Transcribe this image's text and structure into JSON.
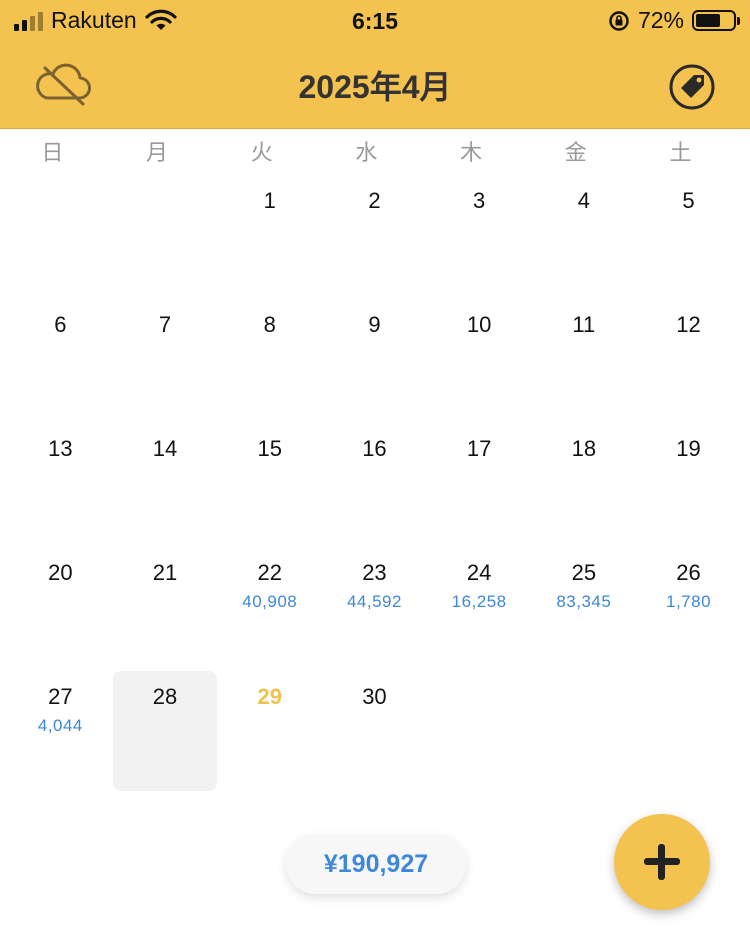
{
  "status_bar": {
    "carrier": "Rakuten",
    "time": "6:15",
    "battery_percent": "72%",
    "battery_level": 0.72,
    "icons": [
      "signal-icon",
      "wifi-icon",
      "rotation-lock-icon",
      "battery-icon"
    ]
  },
  "header": {
    "title": "2025年4月",
    "left_icon": "cloud-off-icon",
    "right_icon": "tag-icon",
    "color": "#F4C24E"
  },
  "weekdays": [
    "日",
    "月",
    "火",
    "水",
    "木",
    "金",
    "土"
  ],
  "calendar": {
    "days": [
      {
        "day": "1",
        "amount": ""
      },
      {
        "day": "2",
        "amount": ""
      },
      {
        "day": "3",
        "amount": ""
      },
      {
        "day": "4",
        "amount": ""
      },
      {
        "day": "5",
        "amount": ""
      },
      {
        "day": "6",
        "amount": ""
      },
      {
        "day": "7",
        "amount": ""
      },
      {
        "day": "8",
        "amount": ""
      },
      {
        "day": "9",
        "amount": ""
      },
      {
        "day": "10",
        "amount": ""
      },
      {
        "day": "11",
        "amount": ""
      },
      {
        "day": "12",
        "amount": ""
      },
      {
        "day": "13",
        "amount": ""
      },
      {
        "day": "14",
        "amount": ""
      },
      {
        "day": "15",
        "amount": ""
      },
      {
        "day": "16",
        "amount": ""
      },
      {
        "day": "17",
        "amount": ""
      },
      {
        "day": "18",
        "amount": ""
      },
      {
        "day": "19",
        "amount": ""
      },
      {
        "day": "20",
        "amount": ""
      },
      {
        "day": "21",
        "amount": ""
      },
      {
        "day": "22",
        "amount": "40,908"
      },
      {
        "day": "23",
        "amount": "44,592"
      },
      {
        "day": "24",
        "amount": "16,258"
      },
      {
        "day": "25",
        "amount": "83,345"
      },
      {
        "day": "26",
        "amount": "1,780"
      },
      {
        "day": "27",
        "amount": "4,044"
      },
      {
        "day": "28",
        "amount": "",
        "today": true
      },
      {
        "day": "29",
        "amount": "",
        "highlight": true
      },
      {
        "day": "30",
        "amount": ""
      }
    ],
    "first_weekday_index": 2
  },
  "footer": {
    "total": "¥190,927",
    "add_icon": "plus-icon"
  },
  "colors": {
    "accent": "#F4C24E",
    "amount": "#3E87D9",
    "weekday": "#999999",
    "today_bg": "#F2F2F2"
  }
}
